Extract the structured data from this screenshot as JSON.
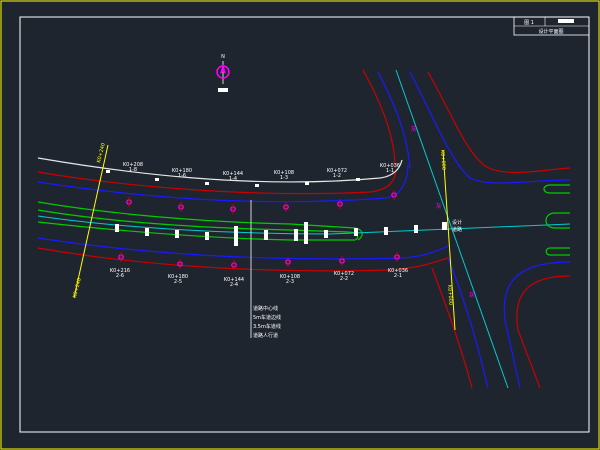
{
  "colors": {
    "background": "#1f252e",
    "outer_frame": "#ffff00",
    "inner_frame": "#ffffff",
    "road_edge": "#cc0000",
    "lane_line": "#0000cc",
    "centerline": "#00cccc",
    "median": "#00cc00",
    "stake_marker": "#ff00ff",
    "chainage_text": "#ffffff",
    "crossroad_text": "#ffff00"
  },
  "north_arrow": {
    "label": "N"
  },
  "title_block": {
    "cells": [
      "图 1",
      "",
      "设计平面图"
    ]
  },
  "top_stakes": [
    {
      "chainage": "K0+208",
      "num": "1-8"
    },
    {
      "chainage": "K0+180",
      "num": "1-6"
    },
    {
      "chainage": "K0+144",
      "num": "1-4"
    },
    {
      "chainage": "K0+108",
      "num": "1-3"
    },
    {
      "chainage": "K0+072",
      "num": "1-2"
    },
    {
      "chainage": "K0+036",
      "num": "1-1"
    }
  ],
  "bottom_stakes": [
    {
      "chainage": "K0+216",
      "num": "2-6"
    },
    {
      "chainage": "K0+180",
      "num": "2-5"
    },
    {
      "chainage": "K0+144",
      "num": "2-4"
    },
    {
      "chainage": "K0+108",
      "num": "2-3"
    },
    {
      "chainage": "K0+072",
      "num": "2-2"
    },
    {
      "chainage": "K0+036",
      "num": "2-1"
    }
  ],
  "left_boundary": {
    "top": "K0+240",
    "bottom": "K0+240"
  },
  "right_boundary": {
    "top": "K0+000",
    "bottom": "K0+000"
  },
  "intersection": {
    "label": "设计",
    "sub": "道路"
  },
  "intersection_marks": [
    "灰",
    "灰",
    "灰"
  ],
  "legend": {
    "items": [
      "道路中心线",
      "5m车道边线",
      "3.5m车道线",
      "道路人行道"
    ]
  }
}
